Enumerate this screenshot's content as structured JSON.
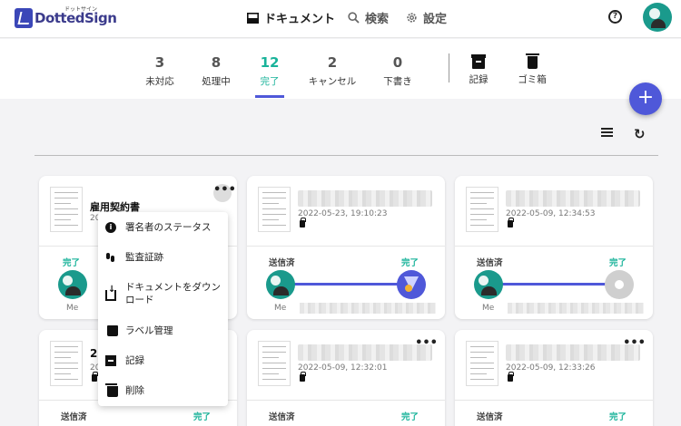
{
  "brand": {
    "name": "DottedSign",
    "subtitle": "ドットサイン"
  },
  "nav": {
    "documents": "ドキュメント",
    "search": "検索",
    "settings": "設定",
    "help": "?"
  },
  "status_tabs": [
    {
      "count": "3",
      "label": "未対応"
    },
    {
      "count": "8",
      "label": "処理中"
    },
    {
      "count": "12",
      "label": "完了",
      "active": true
    },
    {
      "count": "2",
      "label": "キャンセル"
    },
    {
      "count": "0",
      "label": "下書き"
    }
  ],
  "archive_tabs": [
    {
      "label": "記録"
    },
    {
      "label": "ゴミ箱"
    }
  ],
  "fab": "+",
  "cards": [
    {
      "title": "雇用契約書",
      "date": "20",
      "right_label": "完了",
      "left_label": "",
      "me": "Me"
    },
    {
      "title": "",
      "date": "2022-05-23, 19:10:23",
      "left_label": "送信済",
      "right_label": "完了",
      "me": "Me"
    },
    {
      "title": "",
      "date": "2022-05-09, 12:34:53",
      "left_label": "送信済",
      "right_label": "完了",
      "me": "Me"
    },
    {
      "title": "20",
      "date": "20",
      "left_label": "送信済",
      "right_label": "完了"
    },
    {
      "title": "",
      "date": "2022-05-09, 12:32:01",
      "left_label": "送信済",
      "right_label": "完了"
    },
    {
      "title": "",
      "date": "2022-05-09, 12:33:26",
      "left_label": "送信済",
      "right_label": "完了"
    }
  ],
  "context_menu": [
    {
      "label": "署名者のステータス",
      "icon": "info-icon"
    },
    {
      "label": "監査証跡",
      "icon": "footprint-icon"
    },
    {
      "label": "ドキュメントをダウンロード",
      "icon": "download-icon"
    },
    {
      "label": "ラベル管理",
      "icon": "tag-icon"
    },
    {
      "label": "記録",
      "icon": "archive-icon"
    },
    {
      "label": "削除",
      "icon": "trash-icon"
    }
  ],
  "colors": {
    "accent": "#4f58d9",
    "done": "#19b39a",
    "avatar": "#1a9a8c"
  }
}
